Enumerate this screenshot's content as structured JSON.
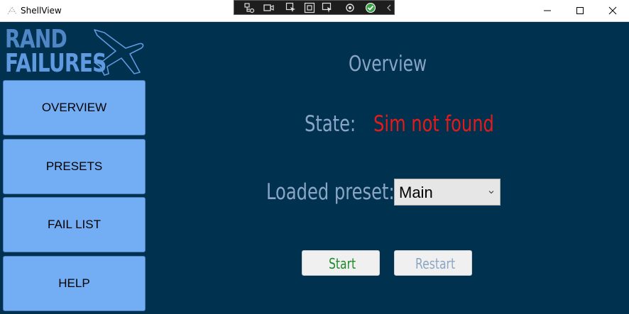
{
  "window": {
    "title": "ShellView",
    "controls": [
      "minimize-icon",
      "maximize-icon",
      "close-icon"
    ]
  },
  "debug_toolbar": {
    "icons": [
      "live-visual-tree-icon",
      "record-icon",
      "select-element-icon",
      "display-layout-adorners-icon",
      "track-focused-element-icon",
      "hot-reload-icon",
      "binding-check-icon",
      "collapse-toolbar-icon"
    ]
  },
  "logo": {
    "line1": "RAND",
    "line2": "FAILURES",
    "icon": "plane-icon"
  },
  "sidebar": {
    "items": [
      {
        "label": "OVERVIEW"
      },
      {
        "label": "PRESETS"
      },
      {
        "label": "FAIL LIST"
      },
      {
        "label": "HELP"
      }
    ]
  },
  "main": {
    "title": "Overview",
    "state_label": "State:",
    "state_value": "Sim not found",
    "preset_label": "Loaded preset:",
    "preset_selected": "Main",
    "start_label": "Start",
    "restart_label": "Restart"
  },
  "colors": {
    "background": "#00314f",
    "nav_button": "#73aef5",
    "label_text": "#8aa6c4",
    "error_text": "#e21b1b",
    "start_text": "#1f8a2a",
    "restart_text": "#8aa6c4",
    "logo": "#5f9ae0"
  }
}
